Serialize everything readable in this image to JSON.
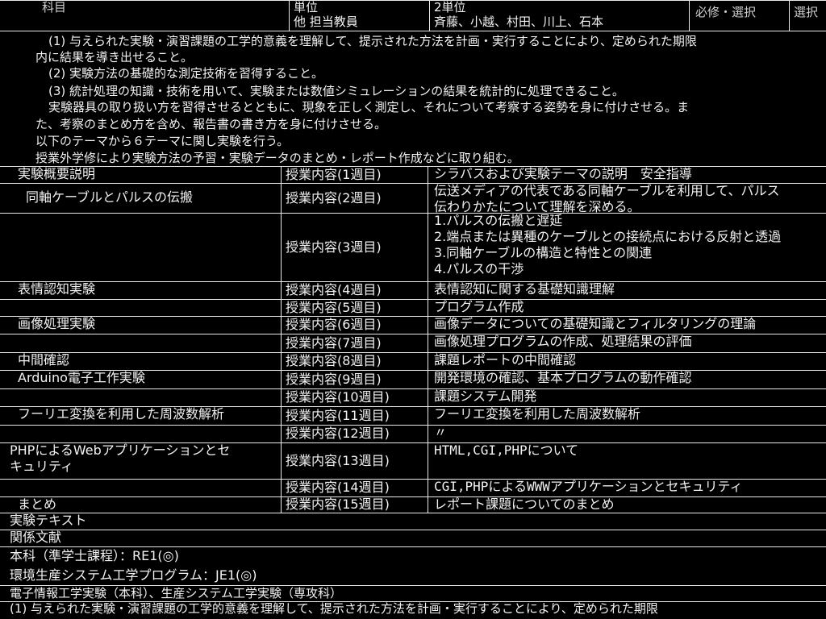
{
  "header": {
    "col1": "科目",
    "unit_label": "単位",
    "unit_value": "2単位",
    "teacher_label": "他 担当教員",
    "teacher_value": "斉藤、小越、村田、川上、石本",
    "col4": "必修・選択",
    "col5": "選択"
  },
  "goals": [
    "(1) 与えられた実験・演習課題の工学的意義を理解して、提示された方法を計画・実行することにより、定められた期限",
    "内に結果を導き出せること。",
    "(2) 実験方法の基礎的な測定技術を習得すること。",
    "(3) 統計処理の知識・技術を用いて、実験または数値シミュレーションの結果を統計的に処理できること。",
    "実験器具の取り扱い方を習得させるとともに、現象を正しく測定し、それについて考察する姿勢を身に付けさせる。ま",
    "た、考察のまとめ方を含め、報告書の書き方を身に付けさせる。",
    "以下のテーマから６テーマに関し実験を行う。",
    "授業外学修により実験方法の予習・実験データのまとめ・レポート作成などに取り組む。"
  ],
  "schedule": [
    {
      "theme": "実験概要説明",
      "session": "授業内容(1週目)",
      "content": [
        "シラバスおよび実験テーマの説明　安全指導"
      ]
    },
    {
      "theme": "同軸ケーブルとパルスの伝搬",
      "session": "授業内容(2週目)",
      "content": [
        "伝送メディアの代表である同軸ケーブルを利用して、パルス",
        "伝わりかたについて理解を深める。"
      ]
    },
    {
      "theme": "",
      "session": "授業内容(3週目)",
      "content": [
        "1.パルスの伝搬と遅延",
        "2.端点または異種のケーブルとの接続点における反射と透過",
        "3.同軸ケーブルの構造と特性との関連",
        "4.パルスの干渉"
      ]
    },
    {
      "theme": "表情認知実験",
      "session": "授業内容(4週目)",
      "content": [
        "表情認知に関する基礎知識理解"
      ]
    },
    {
      "theme": "",
      "session": "授業内容(5週目)",
      "content": [
        "プログラム作成"
      ]
    },
    {
      "theme": "画像処理実験",
      "session": "授業内容(6週目)",
      "content": [
        "画像データについての基礎知識とフィルタリングの理論"
      ]
    },
    {
      "theme": "",
      "session": "授業内容(7週目)",
      "content": [
        "画像処理プログラムの作成、処理結果の評価"
      ]
    },
    {
      "theme": "中間確認",
      "session": "授業内容(8週目)",
      "content": [
        "課題レポートの中間確認"
      ]
    },
    {
      "theme": "Arduino電子工作実験",
      "session": "授業内容(9週目)",
      "content": [
        "開発環境の確認、基本プログラムの動作確認"
      ]
    },
    {
      "theme": "",
      "session": "授業内容(10週目)",
      "content": [
        "課題システム開発"
      ]
    },
    {
      "theme": "フーリエ変換を利用した周波数解析",
      "session": "授業内容(11週目)",
      "content": [
        "フーリエ変換を利用した周波数解析"
      ]
    },
    {
      "theme": "",
      "session": "授業内容(12週目)",
      "content": [
        "〃"
      ]
    },
    {
      "theme": "PHPによるWebアプリケーションとセキュリティ",
      "theme_lines": [
        "PHPによるWebアプリケーションとセ",
        "キュリティ"
      ],
      "session": "授業内容(13週目)",
      "content": [
        "HTML,CGI,PHPについて"
      ]
    },
    {
      "theme": "",
      "session": "授業内容(14週目)",
      "content": [
        "CGI,PHPによるWWWアプリケーションとセキュリティ"
      ]
    },
    {
      "theme": "まとめ",
      "session": "授業内容(15週目)",
      "content": [
        "レポート課題についてのまとめ"
      ]
    }
  ],
  "footer": {
    "textbook": "実験テキスト",
    "references": "関係文献",
    "program1": "本科（準学士課程）：RE1(◎)",
    "program2": "環境生産システム工学プログラム：JE1(◎)",
    "related": "電子情報工学実験（本科）、生産システム工学実験（専攻科）",
    "goal_repeat": "(1) 与えられた実験・演習課題の工学的意義を理解して、提示された方法を計画・実行することにより、定められた期限"
  }
}
